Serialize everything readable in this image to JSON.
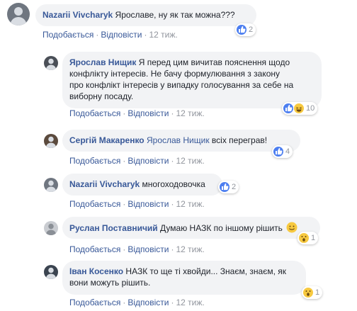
{
  "comments": [
    {
      "author": "Nazarii Vivcharyk",
      "tag": "",
      "text": "Ярославе, ну як так можна???",
      "actions": {
        "like": "Подобається",
        "reply": "Відповісти",
        "time": "12 тиж."
      },
      "reactions": {
        "icons": [
          "like-icon"
        ],
        "count": "2"
      }
    },
    {
      "author": "Ярослав Нищик",
      "tag": "",
      "text_lines": [
        "Я перед цим вичитав пояснення щодо",
        "конфлікту інтересів. Не бачу формулювання з закону",
        "про конфлікт інтересів у випадку голосування за себе на",
        "виборну посаду."
      ],
      "actions": {
        "like": "Подобається",
        "reply": "Відповісти",
        "time": "12 тиж."
      },
      "reactions": {
        "icons": [
          "like-icon",
          "haha-icon"
        ],
        "count": "10"
      }
    },
    {
      "author": "Сергій Макаренко",
      "tag": "Ярослав Нищик",
      "text": "всіх переграв!",
      "actions": {
        "like": "Подобається",
        "reply": "Відповісти",
        "time": "12 тиж."
      },
      "reactions": {
        "icons": [
          "like-icon"
        ],
        "count": "4"
      }
    },
    {
      "author": "Nazarii Vivcharyk",
      "tag": "",
      "text": "многоходовочка",
      "actions": {
        "like": "Подобається",
        "reply": "Відповісти",
        "time": "12 тиж."
      },
      "reactions": {
        "icons": [
          "like-icon"
        ],
        "count": "2"
      }
    },
    {
      "author": "Руслан Поставничий",
      "tag": "",
      "text": "Думаю НАЗК по іншому рішить",
      "emoji": "smile-emoji",
      "actions": {
        "like": "Подобається",
        "reply": "Відповісти",
        "time": "12 тиж."
      },
      "reactions": {
        "icons": [
          "wow-icon"
        ],
        "count": "1"
      }
    },
    {
      "author": "Іван Косенко",
      "tag": "",
      "text_lines": [
        "НАЗК то ще ті хвойди... Знаєм, знаєм, як",
        "вони можуть рішить."
      ],
      "actions": {
        "like": "Подобається",
        "reply": "Відповісти",
        "time": "12 тиж."
      },
      "reactions": {
        "icons": [
          "wow-icon"
        ],
        "count": "1"
      }
    }
  ],
  "colors": {
    "link": "#385898",
    "bubble": "#f2f3f5",
    "meta": "#90949c",
    "like": "#4c7ef0"
  }
}
